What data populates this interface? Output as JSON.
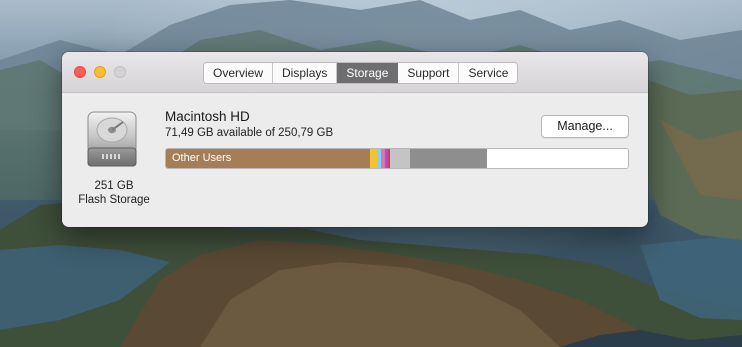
{
  "window": {
    "tabs": [
      {
        "label": "Overview"
      },
      {
        "label": "Displays"
      },
      {
        "label": "Storage",
        "active": true
      },
      {
        "label": "Support"
      },
      {
        "label": "Service"
      }
    ]
  },
  "disk": {
    "icon": "hard-drive-icon",
    "size_label": "251 GB",
    "type_label": "Flash Storage"
  },
  "volume": {
    "name": "Macintosh HD",
    "available": "71,49 GB available of 250,79 GB",
    "manage_label": "Manage...",
    "bar_label": "Other Users",
    "segments": [
      {
        "label": "Other Users",
        "fraction": 0.441,
        "color": "#a57e57"
      },
      {
        "fraction": 0.015,
        "color": "#f4c430"
      },
      {
        "fraction": 0.01,
        "color": "#7ed3f0"
      },
      {
        "fraction": 0.008,
        "color": "#e86fb7"
      },
      {
        "fraction": 0.006,
        "color": "#9b59d0"
      },
      {
        "fraction": 0.004,
        "color": "#d23a5a"
      },
      {
        "fraction": 0.045,
        "color": "#c4c4c4"
      },
      {
        "fraction": 0.167,
        "color": "#8e8e8e"
      },
      {
        "fraction": 0.304,
        "color": "#ffffff"
      }
    ]
  }
}
